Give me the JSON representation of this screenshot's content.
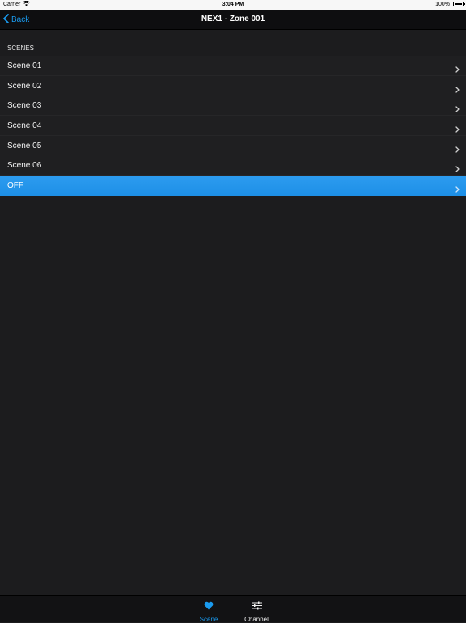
{
  "status_bar": {
    "carrier": "Carrier",
    "time": "3:04 PM",
    "battery": "100%"
  },
  "nav": {
    "back_label": "Back",
    "title": "NEX1 - Zone 001"
  },
  "section_header": "SCENES",
  "scenes": [
    {
      "label": "Scene 01"
    },
    {
      "label": "Scene 02"
    },
    {
      "label": "Scene 03"
    },
    {
      "label": "Scene 04"
    },
    {
      "label": "Scene 05"
    },
    {
      "label": "Scene 06"
    },
    {
      "label": "OFF",
      "selected": true
    }
  ],
  "tabs": [
    {
      "label": "Scene",
      "icon": "heart-icon",
      "active": true
    },
    {
      "label": "Channel",
      "icon": "sliders-icon",
      "active": false
    }
  ],
  "colors": {
    "accent": "#1a9bf0",
    "background": "#1c1c1e",
    "selected_row": "#2d9cf0"
  }
}
